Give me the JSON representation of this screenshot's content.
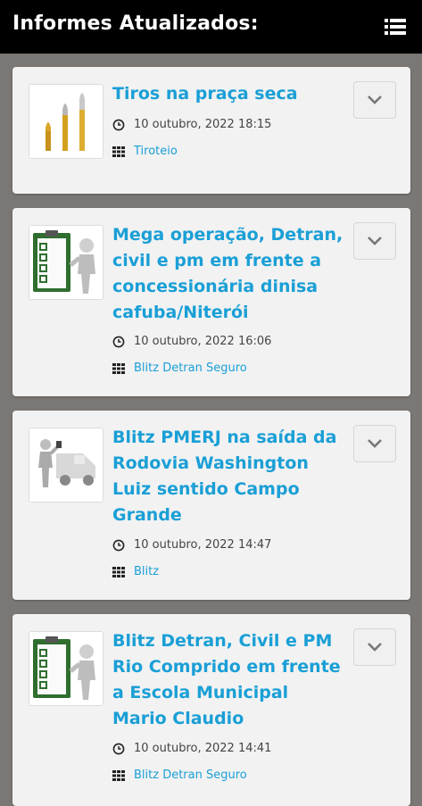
{
  "header": {
    "title": "Informes Atualizados:"
  },
  "posts": [
    {
      "title": "Tiros na praça seca",
      "date": "10 outubro, 2022 18:15",
      "category": "Tiroteio",
      "thumb": "bullets"
    },
    {
      "title": "Mega operação, Detran, civil e pm em frente a concessionária dinisa cafuba/Niterói",
      "date": "10 outubro, 2022 16:06",
      "category": "Blitz Detran Seguro",
      "thumb": "checklist"
    },
    {
      "title": "Blitz PMERJ na saída da Rodovia Washington Luiz sentido Campo Grande",
      "date": "10 outubro, 2022 14:47",
      "category": "Blitz",
      "thumb": "truck"
    },
    {
      "title": "Blitz Detran, Civil e PM Rio Comprido em frente a Escola Municipal Mario Claudio",
      "date": "10 outubro, 2022 14:41",
      "category": "Blitz Detran Seguro",
      "thumb": "checklist"
    }
  ],
  "icons": {
    "menu": "list-menu-icon",
    "clock": "clock-icon",
    "category": "grid-icon",
    "expand": "chevron-down-icon"
  },
  "colors": {
    "accent": "#1a9fd6",
    "header_bg": "#000000",
    "page_bg": "#7a7774",
    "card_bg": "#f2f2f2"
  }
}
